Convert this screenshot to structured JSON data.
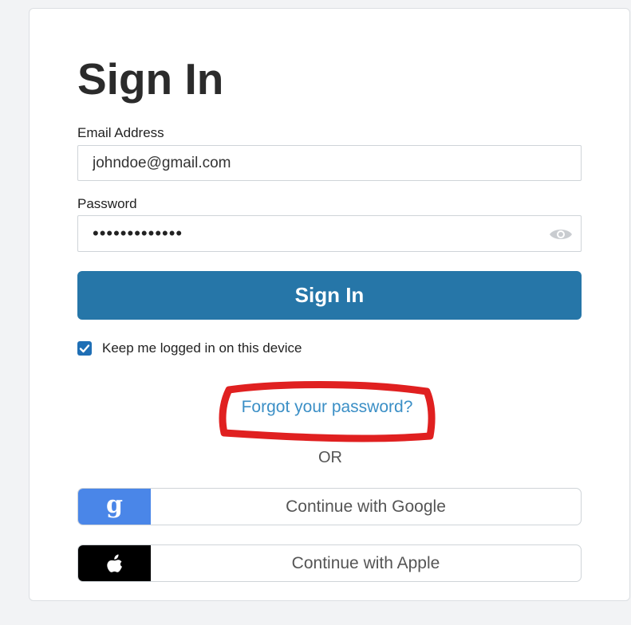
{
  "form": {
    "title": "Sign In",
    "email_label": "Email Address",
    "email_value": "johndoe@gmail.com",
    "password_label": "Password",
    "password_masked": "•••••••••••••",
    "signin_label": "Sign In",
    "keep_logged_in_label": "Keep me logged in on this device",
    "keep_logged_in_checked": true,
    "forgot_label": "Forgot your password?",
    "or_label": "OR"
  },
  "social": {
    "google_label": "Continue with Google",
    "google_icon_glyph": "g",
    "google_icon": "google-icon",
    "apple_label": "Continue with Apple",
    "apple_icon": "apple-icon"
  },
  "colors": {
    "primary": "#2676a8",
    "link": "#3b8fc6",
    "checkbox": "#1f6fb5",
    "google": "#4a86e8",
    "apple": "#000000",
    "annotation": "#e02020"
  }
}
